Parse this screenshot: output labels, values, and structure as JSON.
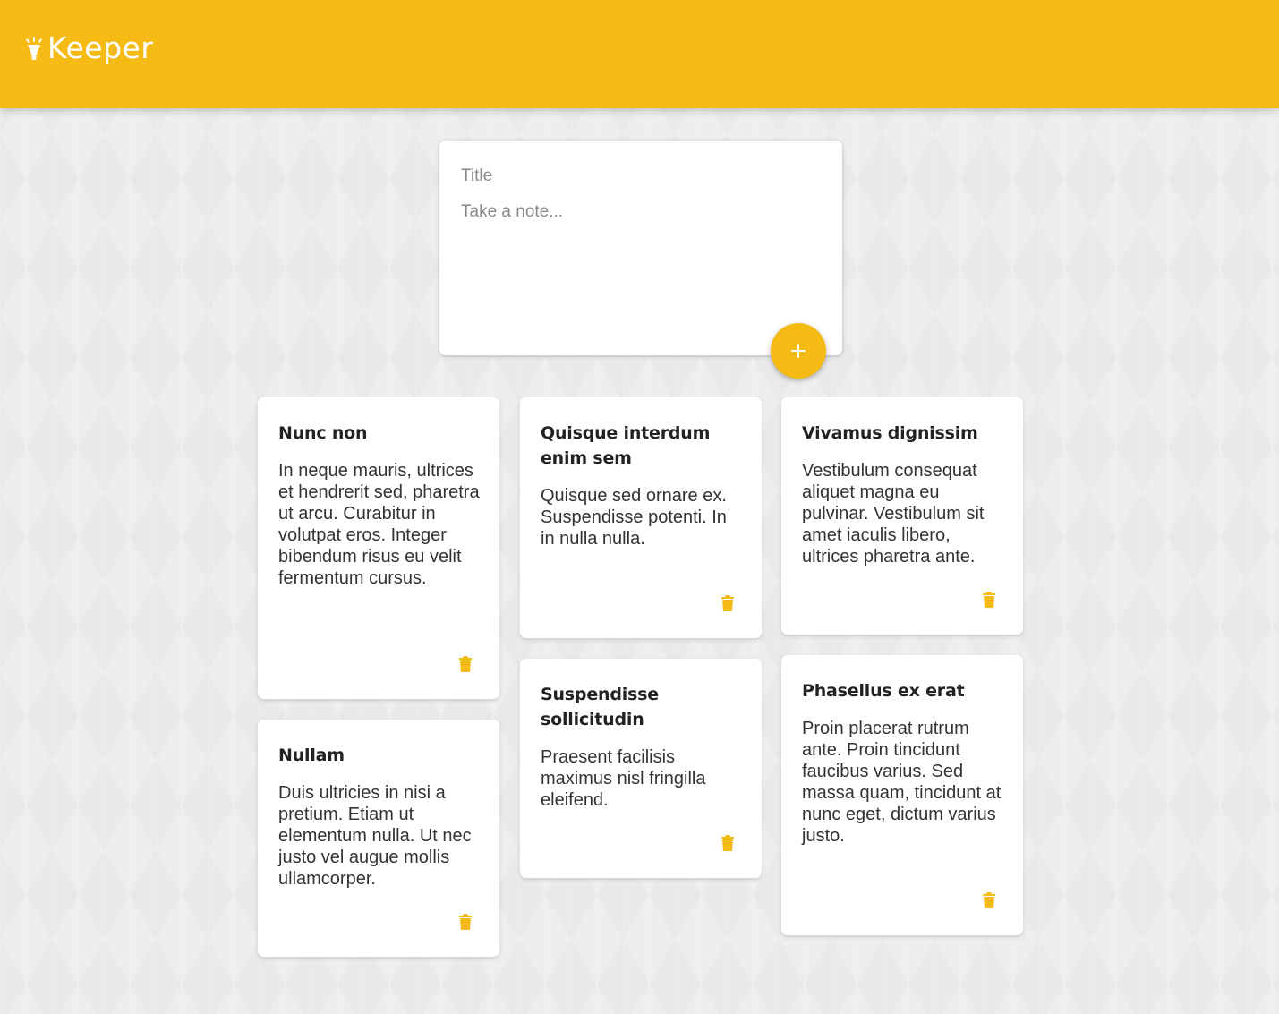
{
  "app": {
    "name": "Keeper",
    "accent": "#f5ba13"
  },
  "composer": {
    "title_placeholder": "Title",
    "content_placeholder": "Take a note...",
    "add_icon": "plus-icon"
  },
  "notes": [
    {
      "title": "Nunc non",
      "content": "In neque mauris, ultrices et hendrerit sed, pharetra ut arcu. Curabitur in volutpat eros. Integer bibendum risus eu velit fermentum cursus."
    },
    {
      "title": "Quisque interdum enim sem",
      "content": "Quisque sed ornare ex. Suspendisse potenti. In in nulla nulla."
    },
    {
      "title": "Vivamus dignissim",
      "content": "Vestibulum consequat aliquet magna eu pulvinar. Vestibulum sit amet iaculis libero, ultrices pharetra ante."
    },
    {
      "title": "Nullam",
      "content": "Duis ultricies in nisi a pretium. Etiam ut elementum nulla. Ut nec justo vel augue mollis ullamcorper."
    },
    {
      "title": "Suspendisse sollicitudin",
      "content": "Praesent facilisis maximus nisl fringilla eleifend."
    },
    {
      "title": "Phasellus ex erat",
      "content": "Proin placerat rutrum ante. Proin tincidunt faucibus varius. Sed massa quam, tincidunt at nunc eget, dictum varius justo."
    }
  ],
  "delete_icon": "trash-icon"
}
